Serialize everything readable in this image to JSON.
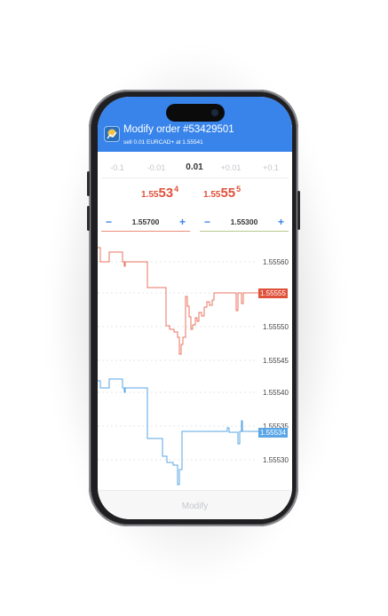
{
  "header": {
    "title": "Modify order #53429501",
    "subtitle": "sell 0.01 EURCAD+ at 1.55541",
    "background_color": "#3884ea"
  },
  "volume_selector": {
    "options": [
      "-0.1",
      "-0.01",
      "0.01",
      "+0.01",
      "+0.1"
    ],
    "selected": "0.01"
  },
  "prices": {
    "bid": {
      "prefix": "1.55",
      "big": "53",
      "sup": "4"
    },
    "ask": {
      "prefix": "1.55",
      "big": "55",
      "sup": "5"
    },
    "color": "#e0513b"
  },
  "stop_loss": {
    "value": "1.55700",
    "minus": "−",
    "plus": "+",
    "underline_color": "#e98d7d"
  },
  "take_profit": {
    "value": "1.55300",
    "minus": "−",
    "plus": "+",
    "underline_color": "#b7c98f"
  },
  "charts": {
    "bid_chart": {
      "ticks": [
        "1.55560",
        "1.55555",
        "1.55550",
        "1.55545"
      ],
      "current_label": "1.55555",
      "line_color": "#e8735f",
      "label_color": "#e0513b"
    },
    "ask_chart": {
      "ticks": [
        "1.55540",
        "1.55535",
        "1.55530"
      ],
      "current_label": "1.55534",
      "line_color": "#5aa6e6",
      "label_color": "#5aa6e6"
    }
  },
  "footer": {
    "modify_label": "Modify"
  },
  "icons": {
    "app": "trading-app-icon"
  }
}
